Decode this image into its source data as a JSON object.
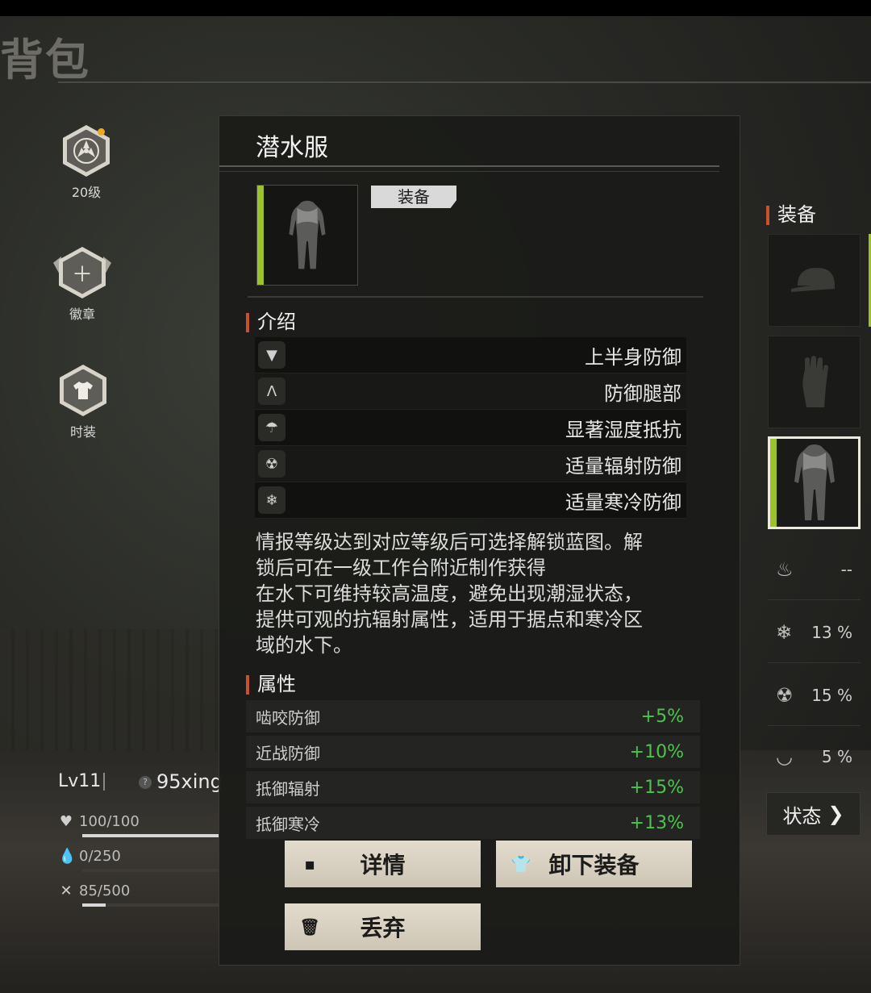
{
  "page": {
    "title": "背包"
  },
  "sidebar": {
    "items": [
      {
        "label": "20级",
        "icon": "fan-emblem-icon",
        "has_dot": true
      },
      {
        "label": "徽章",
        "icon": "plus-icon"
      },
      {
        "label": "时装",
        "icon": "shirt-icon"
      }
    ]
  },
  "player": {
    "level": "Lv11",
    "name": "95xing",
    "health": {
      "text": "100/100",
      "value": 100,
      "max": 100
    },
    "water": {
      "text": "0/250",
      "value": 0,
      "max": 250
    },
    "food": {
      "text": "85/500",
      "value": 85,
      "max": 500
    }
  },
  "item": {
    "name": "潜水服",
    "tag": "装备",
    "intro_title": "介绍",
    "intro": [
      {
        "icon": "torso-armor-icon",
        "text": "上半身防御"
      },
      {
        "icon": "legs-armor-icon",
        "text": "防御腿部"
      },
      {
        "icon": "umbrella-shield-icon",
        "text": "显著湿度抵抗"
      },
      {
        "icon": "gasmask-shield-icon",
        "text": "适量辐射防御"
      },
      {
        "icon": "snowflake-shield-icon",
        "text": "适量寒冷防御"
      }
    ],
    "description": [
      "情报等级达到对应等级后可选择解锁蓝图。解",
      "锁后可在一级工作台附近制作获得",
      "在水下可维持较高温度，避免出现潮湿状态，",
      "提供可观的抗辐射属性，适用于据点和寒冷区",
      "域的水下。"
    ],
    "attr_title": "属性",
    "attributes": [
      {
        "name": "啮咬防御",
        "value": "+5%"
      },
      {
        "name": "近战防御",
        "value": "+10%"
      },
      {
        "name": "抵御辐射",
        "value": "+15%"
      },
      {
        "name": "抵御寒冷",
        "value": "+13%"
      }
    ],
    "buttons": {
      "details": "详情",
      "unequip": "卸下装备",
      "discard": "丢弃"
    }
  },
  "equipment": {
    "title": "装备",
    "slots": [
      "cap-icon",
      "glove-icon",
      "wetsuit-icon"
    ],
    "resistances": [
      {
        "icon": "fire-icon",
        "value": "--"
      },
      {
        "icon": "snowflake-icon",
        "value": "13 %"
      },
      {
        "icon": "gasmask-icon",
        "value": "15 %"
      },
      {
        "icon": "fang-icon",
        "value": "5 %"
      }
    ],
    "state_button": "状态",
    "state_arrow": "❯"
  },
  "colors": {
    "accent": "#c8522b",
    "green": "#9bc12c",
    "positive": "#4cc44c"
  }
}
